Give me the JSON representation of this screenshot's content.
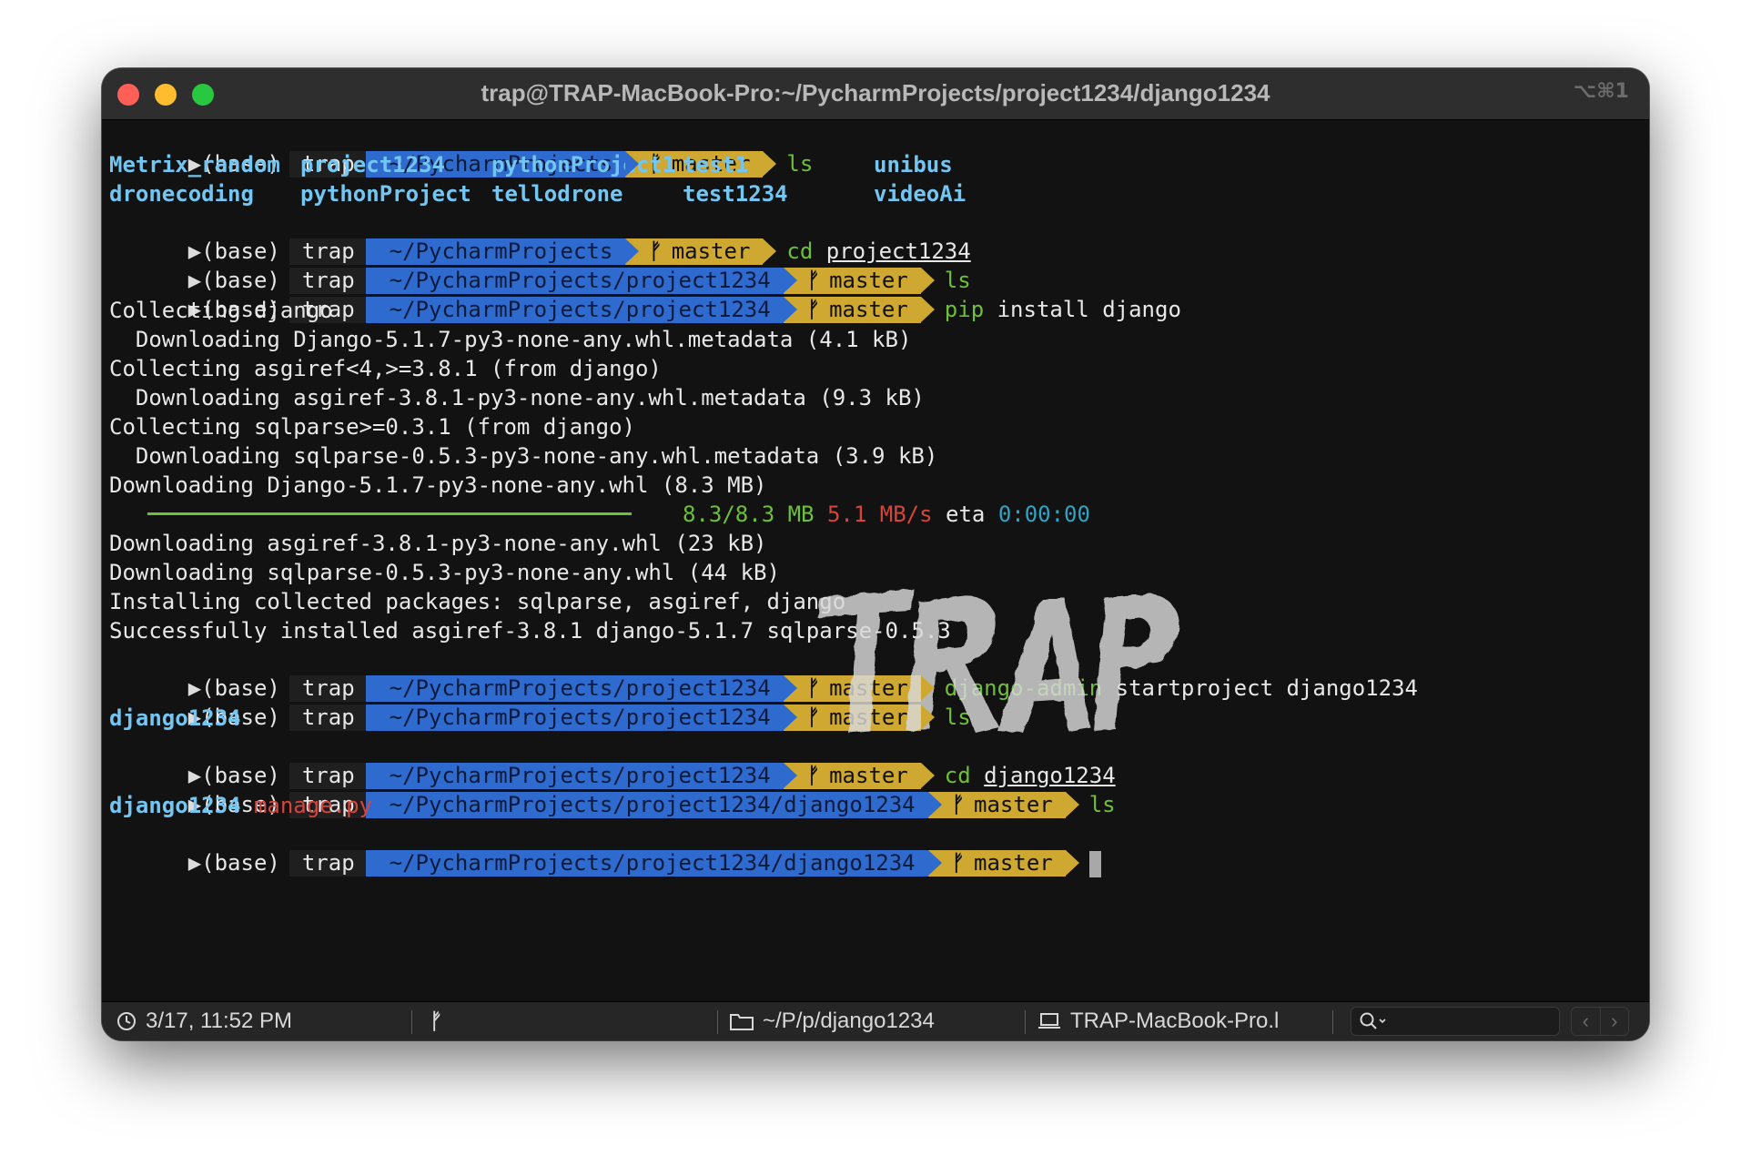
{
  "window": {
    "title": "trap@TRAP-MacBook-Pro:~/PycharmProjects/project1234/django1234",
    "shortcut": "⌥⌘1"
  },
  "prompt": {
    "env": "(base)",
    "user": "trap",
    "branch": "master"
  },
  "paths": {
    "p1": "~/PycharmProjects",
    "p2": "~/PycharmProjects/project1234",
    "p3": "~/PycharmProjects/project1234/django1234"
  },
  "commands": {
    "c1": "ls",
    "c2_kw": "cd",
    "c2_arg": "project1234",
    "c3": "ls",
    "c4_kw": "pip",
    "c4_arg": "install django",
    "c5_kw": "django-admin",
    "c5_arg": "startproject django1234",
    "c6": "ls",
    "c7_kw": "cd",
    "c7_arg": "django1234",
    "c8": "ls"
  },
  "ls_output": {
    "row1": [
      "Metrix_random",
      "project1234",
      "pythonProject1",
      "test1",
      "unibus"
    ],
    "row2": [
      "dronecoding",
      "pythonProject",
      "tellodrone",
      "test1234",
      "videoAi"
    ]
  },
  "pip_output": {
    "l1": "Collecting django",
    "l2": "  Downloading Django-5.1.7-py3-none-any.whl.metadata (4.1 kB)",
    "l3": "Collecting asgiref<4,>=3.8.1 (from django)",
    "l4": "  Downloading asgiref-3.8.1-py3-none-any.whl.metadata (9.3 kB)",
    "l5": "Collecting sqlparse>=0.3.1 (from django)",
    "l6": "  Downloading sqlparse-0.5.3-py3-none-any.whl.metadata (3.9 kB)",
    "l7": "Downloading Django-5.1.7-py3-none-any.whl (8.3 MB)",
    "progress_size": "8.3/8.3 MB",
    "progress_speed": "5.1 MB/s",
    "progress_eta_label": "eta",
    "progress_eta": "0:00:00",
    "progress_fraction": 1.0,
    "l8": "Downloading asgiref-3.8.1-py3-none-any.whl (23 kB)",
    "l9": "Downloading sqlparse-0.5.3-py3-none-any.whl (44 kB)",
    "l10": "Installing collected packages: sqlparse, asgiref, django",
    "l11": "Successfully installed asgiref-3.8.1 django-5.1.7 sqlparse-0.5.3"
  },
  "ls2_output": {
    "dir": "django1234"
  },
  "ls3_output": {
    "dir": "django1234",
    "file": "manage.py"
  },
  "watermark": {
    "text": "TRAP"
  },
  "statusbar": {
    "clock": "3/17, 11:52 PM",
    "folder": "~/P/p/django1234",
    "host": "TRAP-MacBook-Pro.l"
  },
  "colors": {
    "path_bg": "#2f6bce",
    "branch_bg": "#cfa831",
    "command_green": "#6fbf3a",
    "dir_blue": "#74c6f2",
    "error_red": "#d6453b"
  }
}
